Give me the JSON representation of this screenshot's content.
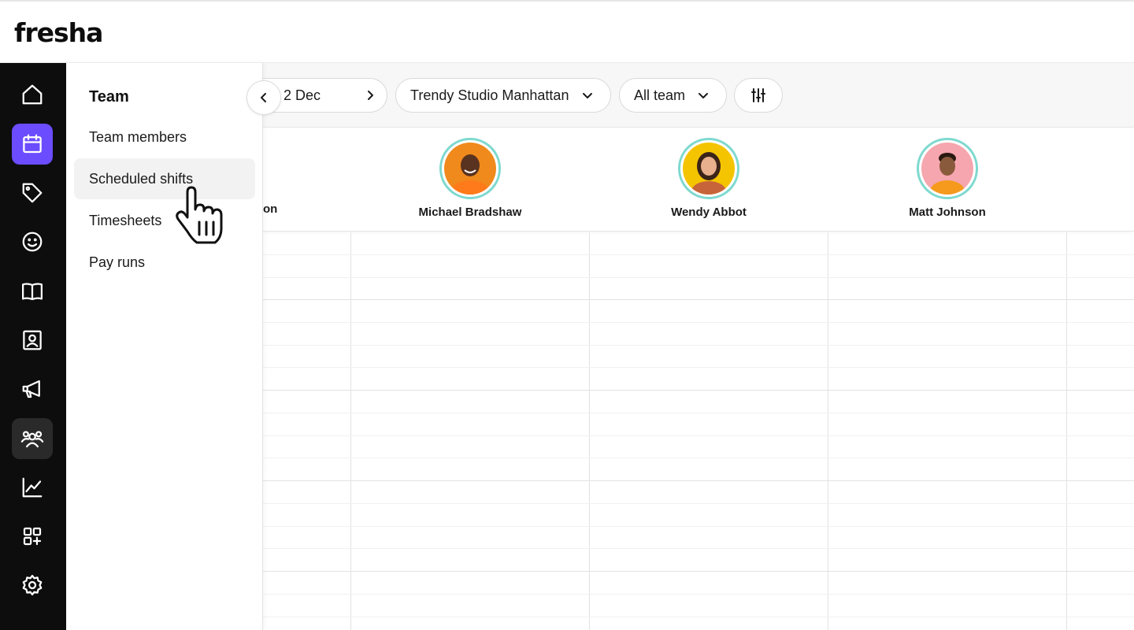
{
  "app": {
    "logo": "fresha"
  },
  "rail": {
    "items": [
      {
        "icon": "home-icon"
      },
      {
        "icon": "calendar-icon",
        "active": true
      },
      {
        "icon": "tag-icon"
      },
      {
        "icon": "smile-icon"
      },
      {
        "icon": "book-icon"
      },
      {
        "icon": "contact-card-icon"
      },
      {
        "icon": "megaphone-icon"
      },
      {
        "icon": "team-icon",
        "active": true
      },
      {
        "icon": "chart-icon"
      },
      {
        "icon": "add-apps-icon"
      },
      {
        "icon": "gear-icon"
      }
    ],
    "accent": "#6b4dff"
  },
  "submenu": {
    "title": "Team",
    "items": [
      {
        "label": "Team members"
      },
      {
        "label": "Scheduled shifts",
        "selected": true
      },
      {
        "label": "Timesheets"
      },
      {
        "label": "Pay runs"
      }
    ]
  },
  "toolbar": {
    "date_label": "2 Dec",
    "location": "Trendy Studio Manhattan",
    "team_filter": "All team"
  },
  "members": [
    {
      "name": "Michael Bradshaw",
      "avatar_color": "#f08a1c"
    },
    {
      "name": "Wendy Abbot",
      "avatar_color": "#f5c400"
    },
    {
      "name": "Matt Johnson",
      "avatar_color": "#f6a6ae"
    }
  ],
  "partial_member_name": "on"
}
